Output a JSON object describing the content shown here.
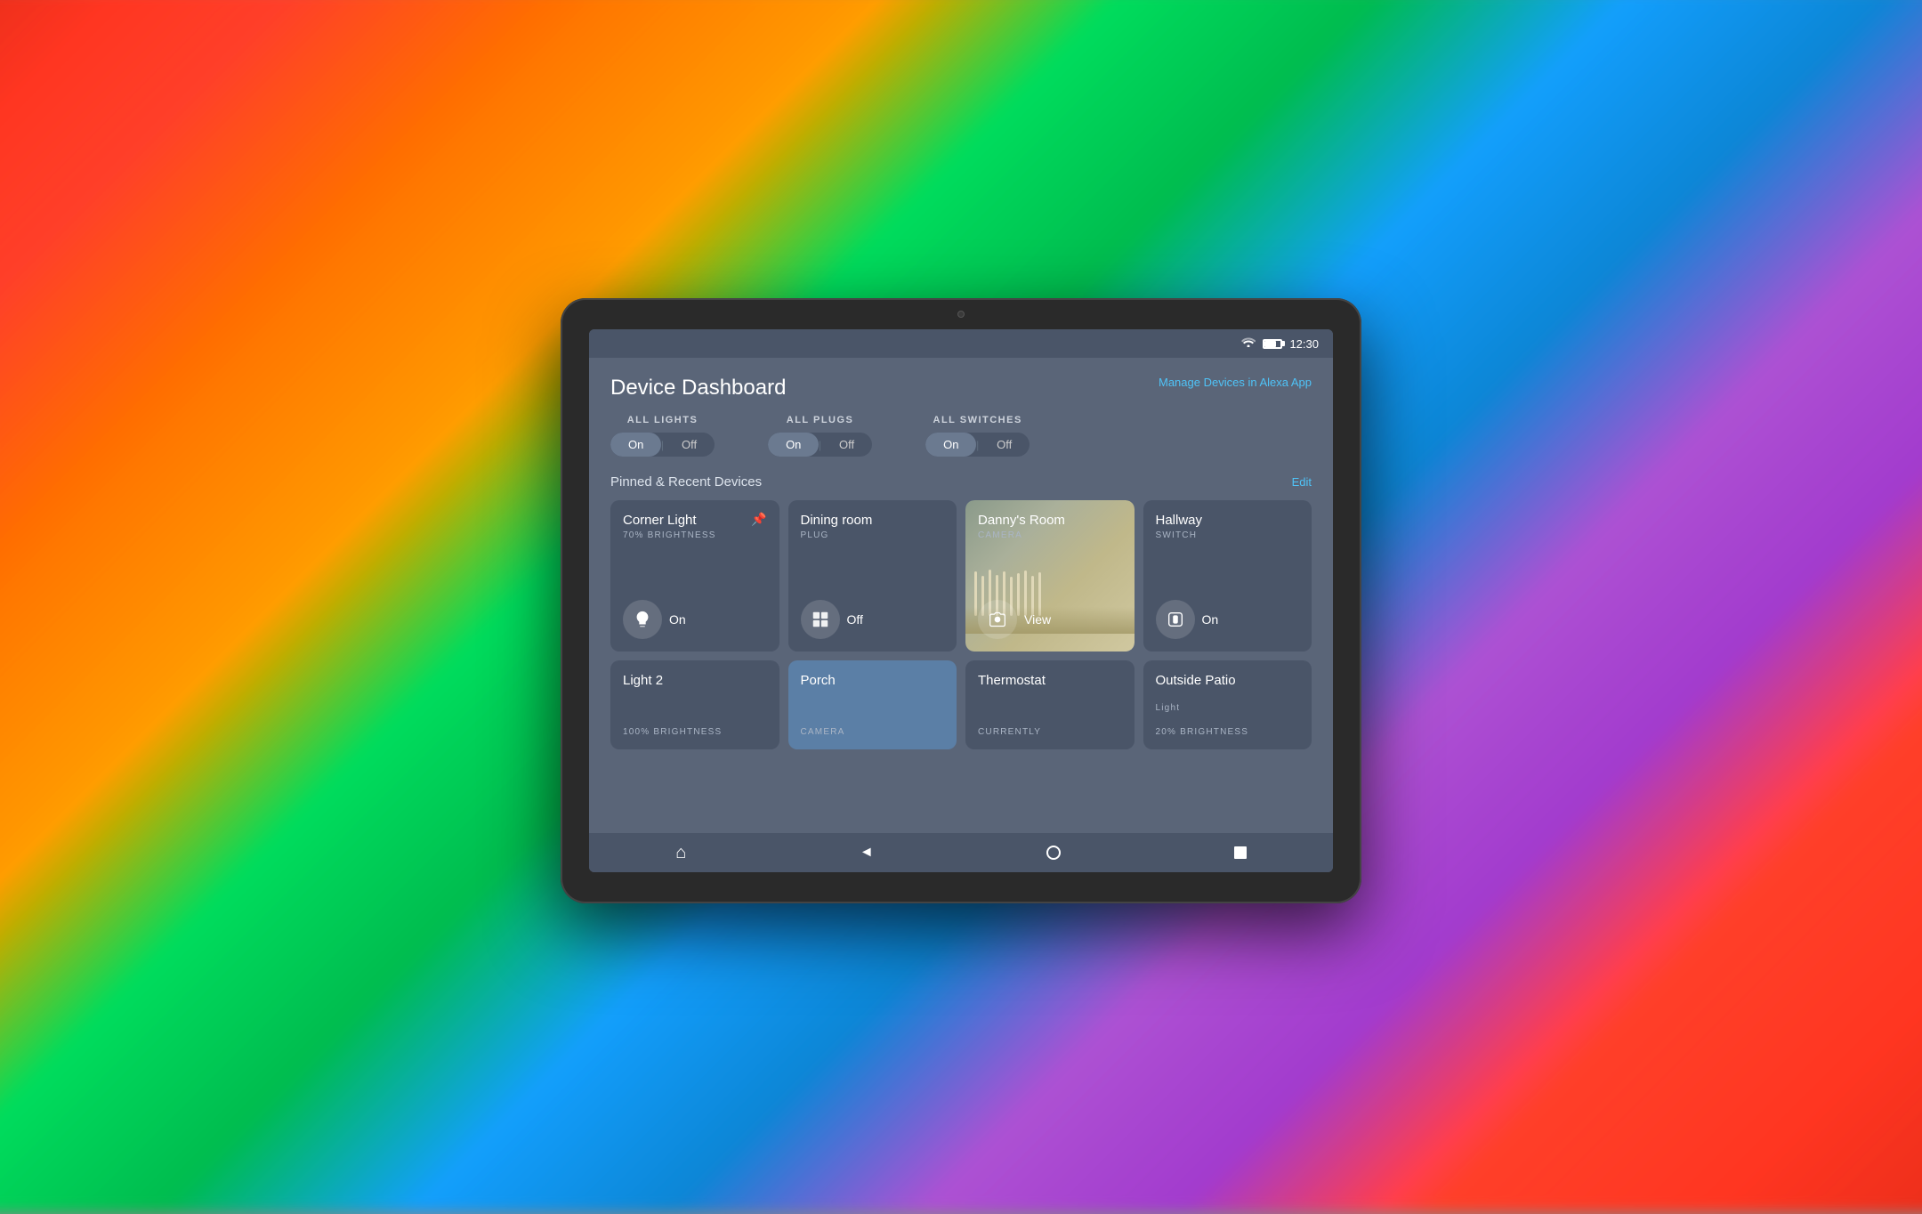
{
  "background": {
    "description": "colorful abstract painting background"
  },
  "statusBar": {
    "time": "12:30",
    "wifiIcon": "wifi",
    "batteryIcon": "battery"
  },
  "header": {
    "title": "Device Dashboard",
    "manageLink": "Manage Devices in Alexa App"
  },
  "allControls": [
    {
      "label": "ALL LIGHTS",
      "onLabel": "On",
      "offLabel": "Off",
      "activeState": "on"
    },
    {
      "label": "ALL PLUGS",
      "onLabel": "On",
      "offLabel": "Off",
      "activeState": "on"
    },
    {
      "label": "ALL SWITCHES",
      "onLabel": "On",
      "offLabel": "Off",
      "activeState": "on"
    }
  ],
  "pinnedSection": {
    "title": "Pinned & Recent Devices",
    "editLabel": "Edit"
  },
  "devices": [
    {
      "name": "Corner Light",
      "type": "70% BRIGHTNESS",
      "status": "On",
      "iconType": "light",
      "pinned": true,
      "highlighted": false,
      "selected": false
    },
    {
      "name": "Dining room",
      "type": "PLUG",
      "status": "Off",
      "iconType": "plug",
      "pinned": false,
      "highlighted": false,
      "selected": false
    },
    {
      "name": "Danny's Room",
      "type": "CAMERA",
      "status": "View",
      "iconType": "camera",
      "pinned": false,
      "highlighted": true,
      "selected": false
    },
    {
      "name": "Hallway",
      "type": "SWITCH",
      "status": "On",
      "iconType": "switch",
      "pinned": false,
      "highlighted": false,
      "selected": false
    },
    {
      "name": "Light 2",
      "type": "100% BRIGHTNESS",
      "status": "",
      "iconType": "light",
      "pinned": false,
      "highlighted": false,
      "selected": false,
      "partial": true
    },
    {
      "name": "Porch",
      "type": "CAMERA",
      "status": "",
      "iconType": "camera",
      "pinned": false,
      "highlighted": false,
      "selected": true,
      "partial": true
    },
    {
      "name": "Thermostat",
      "type": "CURRENTLY",
      "status": "",
      "iconType": "thermostat",
      "pinned": false,
      "highlighted": false,
      "selected": false,
      "partial": true
    },
    {
      "name": "Outside Patio",
      "type": "Light",
      "subtype": "20% BRIGHTNESS",
      "status": "",
      "iconType": "light",
      "pinned": false,
      "highlighted": false,
      "selected": false,
      "partial": true
    }
  ],
  "bottomNav": {
    "homeIcon": "⌂",
    "backIcon": "◄"
  }
}
